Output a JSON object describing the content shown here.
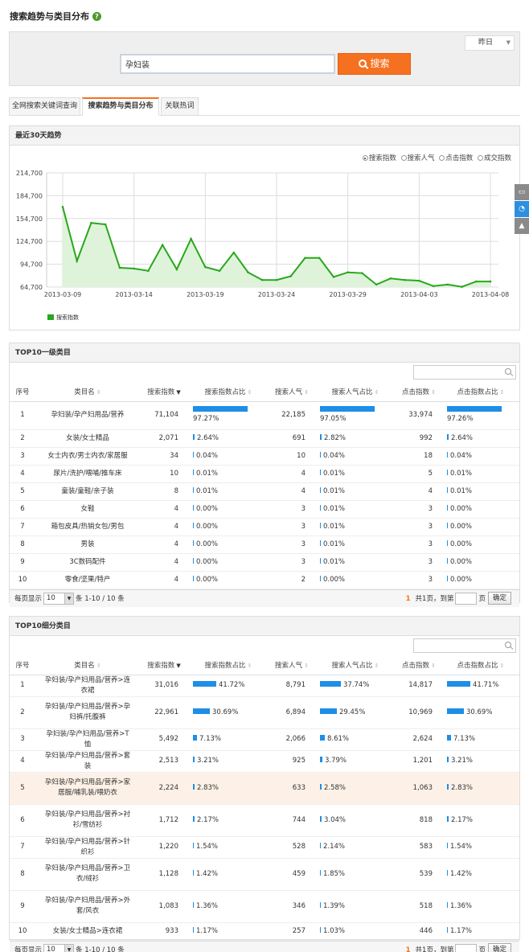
{
  "page": {
    "title": "搜索趋势与类目分布"
  },
  "search": {
    "date_option": "昨日",
    "query": "孕妇装",
    "button_label": "搜索"
  },
  "tabs": [
    {
      "label": "全网搜索关键词查询",
      "active": false
    },
    {
      "label": "搜索趋势与类目分布",
      "active": true
    },
    {
      "label": "关联热词",
      "active": false
    }
  ],
  "trend": {
    "title": "最近30天趋势",
    "metrics": [
      {
        "label": "搜索指数",
        "selected": true
      },
      {
        "label": "搜索人气",
        "selected": false
      },
      {
        "label": "点击指数",
        "selected": false
      },
      {
        "label": "成交指数",
        "selected": false
      }
    ],
    "legend_label": "搜索指数"
  },
  "chart_data": {
    "type": "area",
    "x": [
      "2013-03-09",
      "2013-03-10",
      "2013-03-11",
      "2013-03-12",
      "2013-03-13",
      "2013-03-14",
      "2013-03-15",
      "2013-03-16",
      "2013-03-17",
      "2013-03-18",
      "2013-03-19",
      "2013-03-20",
      "2013-03-21",
      "2013-03-22",
      "2013-03-23",
      "2013-03-24",
      "2013-03-25",
      "2013-03-26",
      "2013-03-27",
      "2013-03-28",
      "2013-03-29",
      "2013-03-30",
      "2013-03-31",
      "2013-04-01",
      "2013-04-02",
      "2013-04-03",
      "2013-04-04",
      "2013-04-05",
      "2013-04-06",
      "2013-04-07",
      "2013-04-08"
    ],
    "x_ticks": [
      "2013-03-09",
      "2013-03-14",
      "2013-03-19",
      "2013-03-24",
      "2013-03-29",
      "2013-04-03",
      "2013-04-08"
    ],
    "y_ticks": [
      "64,700",
      "94,700",
      "124,700",
      "154,700",
      "184,700",
      "214,700"
    ],
    "ylim": [
      64700,
      214700
    ],
    "series": [
      {
        "name": "搜索指数",
        "values": [
          170000,
          99000,
          149000,
          147000,
          90000,
          89000,
          86000,
          120000,
          88000,
          128000,
          91000,
          86000,
          110000,
          84000,
          74000,
          74000,
          79000,
          103000,
          103000,
          78000,
          84000,
          83000,
          68000,
          76000,
          74000,
          73000,
          66000,
          68000,
          65000,
          72000,
          72000
        ]
      }
    ],
    "grid": true,
    "legend": "bottom-left"
  },
  "table_headers": {
    "row_no": "序号",
    "category": "类目名",
    "search_index": "搜索指数",
    "search_index_share": "搜索指数占比",
    "popularity": "搜索人气",
    "popularity_share": "搜索人气占比",
    "click_index": "点击指数",
    "click_index_share": "点击指数占比"
  },
  "top1": {
    "title": "TOP10一级类目",
    "rows": [
      {
        "no": "1",
        "name": "孕妇装/孕产妇用品/营养",
        "si": "71,104",
        "sis": "97.27%",
        "sisv": 97.27,
        "pop": "22,185",
        "pops": "97.05%",
        "popsv": 97.05,
        "ci": "33,974",
        "cis": "97.26%",
        "cisv": 97.26
      },
      {
        "no": "2",
        "name": "女装/女士精品",
        "si": "2,071",
        "sis": "2.64%",
        "sisv": 2.64,
        "pop": "691",
        "pops": "2.82%",
        "popsv": 2.82,
        "ci": "992",
        "cis": "2.64%",
        "cisv": 2.64
      },
      {
        "no": "3",
        "name": "女士内衣/男士内衣/家居服",
        "si": "34",
        "sis": "0.04%",
        "sisv": 0.04,
        "pop": "10",
        "pops": "0.04%",
        "popsv": 0.04,
        "ci": "18",
        "cis": "0.04%",
        "cisv": 0.04
      },
      {
        "no": "4",
        "name": "尿片/洗护/喂哺/推车床",
        "si": "10",
        "sis": "0.01%",
        "sisv": 0.01,
        "pop": "4",
        "pops": "0.01%",
        "popsv": 0.01,
        "ci": "5",
        "cis": "0.01%",
        "cisv": 0.01
      },
      {
        "no": "5",
        "name": "童装/童鞋/亲子装",
        "si": "8",
        "sis": "0.01%",
        "sisv": 0.01,
        "pop": "4",
        "pops": "0.01%",
        "popsv": 0.01,
        "ci": "4",
        "cis": "0.01%",
        "cisv": 0.01
      },
      {
        "no": "6",
        "name": "女鞋",
        "si": "4",
        "sis": "0.00%",
        "sisv": 0,
        "pop": "3",
        "pops": "0.01%",
        "popsv": 0.01,
        "ci": "3",
        "cis": "0.00%",
        "cisv": 0
      },
      {
        "no": "7",
        "name": "箱包皮具/热销女包/男包",
        "si": "4",
        "sis": "0.00%",
        "sisv": 0,
        "pop": "3",
        "pops": "0.01%",
        "popsv": 0.01,
        "ci": "3",
        "cis": "0.00%",
        "cisv": 0
      },
      {
        "no": "8",
        "name": "男装",
        "si": "4",
        "sis": "0.00%",
        "sisv": 0,
        "pop": "3",
        "pops": "0.01%",
        "popsv": 0.01,
        "ci": "3",
        "cis": "0.00%",
        "cisv": 0
      },
      {
        "no": "9",
        "name": "3C数码配件",
        "si": "4",
        "sis": "0.00%",
        "sisv": 0,
        "pop": "3",
        "pops": "0.01%",
        "popsv": 0.01,
        "ci": "3",
        "cis": "0.00%",
        "cisv": 0
      },
      {
        "no": "10",
        "name": "零食/坚果/特产",
        "si": "4",
        "sis": "0.00%",
        "sisv": 0,
        "pop": "2",
        "pops": "0.00%",
        "popsv": 0,
        "ci": "3",
        "cis": "0.00%",
        "cisv": 0
      }
    ]
  },
  "top2": {
    "title": "TOP10细分类目",
    "rows": [
      {
        "no": "1",
        "name": "孕妇装/孕产妇用品/营养>连衣裙",
        "si": "31,016",
        "sis": "41.72%",
        "sisv": 41.72,
        "pop": "8,791",
        "pops": "37.74%",
        "popsv": 37.74,
        "ci": "14,817",
        "cis": "41.71%",
        "cisv": 41.71
      },
      {
        "no": "2",
        "name": "孕妇装/孕产妇用品/营养>孕妇裤/托腹裤",
        "si": "22,961",
        "sis": "30.69%",
        "sisv": 30.69,
        "pop": "6,894",
        "pops": "29.45%",
        "popsv": 29.45,
        "ci": "10,969",
        "cis": "30.69%",
        "cisv": 30.69
      },
      {
        "no": "3",
        "name": "孕妇装/孕产妇用品/营养>T恤",
        "si": "5,492",
        "sis": "7.13%",
        "sisv": 7.13,
        "pop": "2,066",
        "pops": "8.61%",
        "popsv": 8.61,
        "ci": "2,624",
        "cis": "7.13%",
        "cisv": 7.13
      },
      {
        "no": "4",
        "name": "孕妇装/孕产妇用品/营养>套装",
        "si": "2,513",
        "sis": "3.21%",
        "sisv": 3.21,
        "pop": "925",
        "pops": "3.79%",
        "popsv": 3.79,
        "ci": "1,201",
        "cis": "3.21%",
        "cisv": 3.21
      },
      {
        "no": "5",
        "name": "孕妇装/孕产妇用品/营养>家居服/哺乳装/喂奶衣",
        "si": "2,224",
        "sis": "2.83%",
        "sisv": 2.83,
        "pop": "633",
        "pops": "2.58%",
        "popsv": 2.58,
        "ci": "1,063",
        "cis": "2.83%",
        "cisv": 2.83
      },
      {
        "no": "6",
        "name": "孕妇装/孕产妇用品/营养>衬衫/雪纺衫",
        "si": "1,712",
        "sis": "2.17%",
        "sisv": 2.17,
        "pop": "744",
        "pops": "3.04%",
        "popsv": 3.04,
        "ci": "818",
        "cis": "2.17%",
        "cisv": 2.17
      },
      {
        "no": "7",
        "name": "孕妇装/孕产妇用品/营养>针织衫",
        "si": "1,220",
        "sis": "1.54%",
        "sisv": 1.54,
        "pop": "528",
        "pops": "2.14%",
        "popsv": 2.14,
        "ci": "583",
        "cis": "1.54%",
        "cisv": 1.54
      },
      {
        "no": "8",
        "name": "孕妇装/孕产妇用品/营养>卫衣/绒衫",
        "si": "1,128",
        "sis": "1.42%",
        "sisv": 1.42,
        "pop": "459",
        "pops": "1.85%",
        "popsv": 1.85,
        "ci": "539",
        "cis": "1.42%",
        "cisv": 1.42
      },
      {
        "no": "9",
        "name": "孕妇装/孕产妇用品/营养>外套/风衣",
        "si": "1,083",
        "sis": "1.36%",
        "sisv": 1.36,
        "pop": "346",
        "pops": "1.39%",
        "popsv": 1.39,
        "ci": "518",
        "cis": "1.36%",
        "cisv": 1.36
      },
      {
        "no": "10",
        "name": "女装/女士精品>连衣裙",
        "si": "933",
        "sis": "1.17%",
        "sisv": 1.17,
        "pop": "257",
        "pops": "1.03%",
        "popsv": 1.03,
        "ci": "446",
        "cis": "1.17%",
        "cisv": 1.17
      }
    ]
  },
  "pager": {
    "per_page_label": "每页显示",
    "per_page": "10",
    "range": "条 1-10 / 10 条",
    "current": "1",
    "total": "共1页，到第",
    "page_suffix": "页",
    "confirm": "确定"
  },
  "colors": {
    "accent": "#f5711f",
    "series": "#28a81c",
    "bar": "#1e8ee6",
    "highlight_row": "#fdf1e7"
  }
}
